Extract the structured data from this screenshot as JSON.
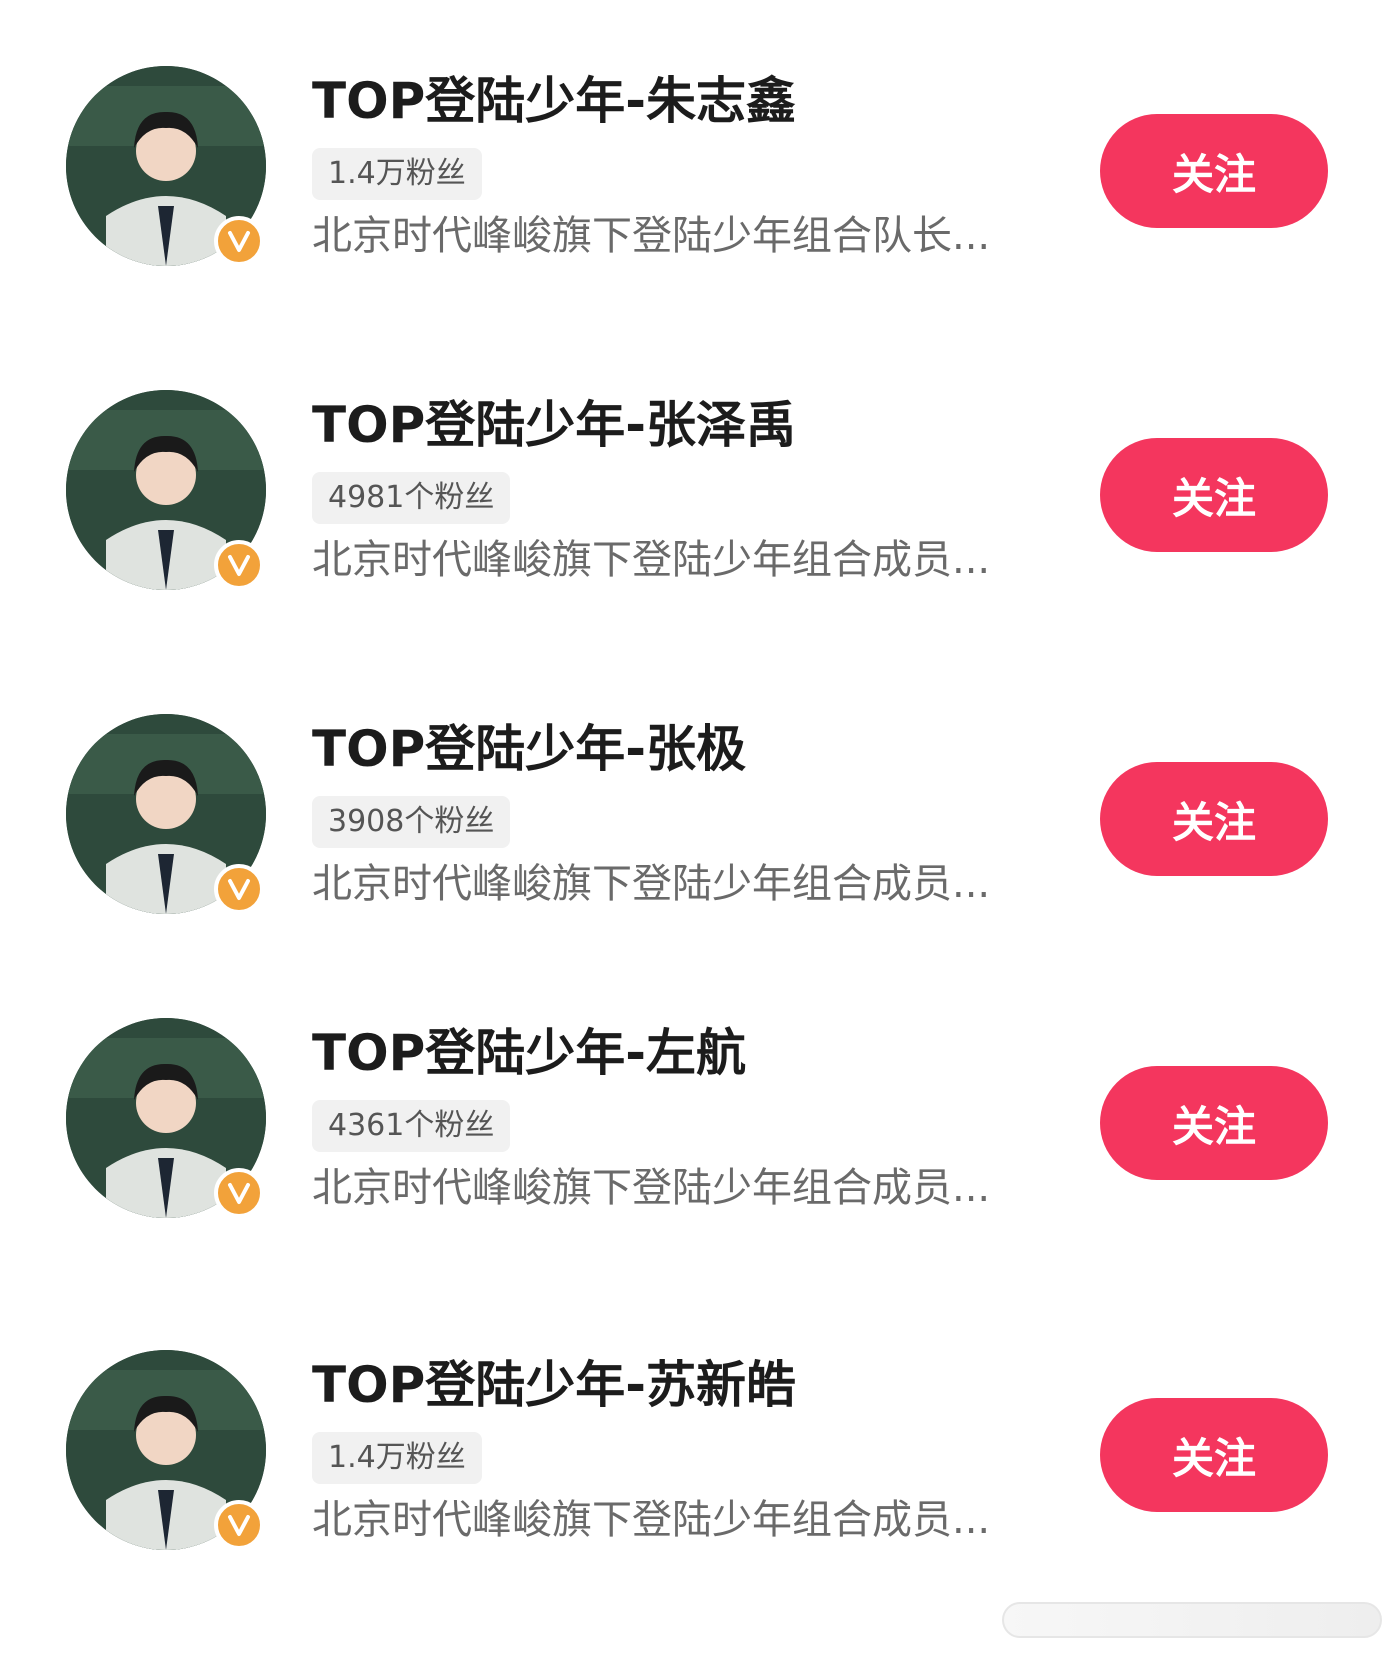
{
  "accounts": [
    {
      "name": "TOP登陆少年-朱志鑫",
      "followers": "1.4万粉丝",
      "description": "北京时代峰峻旗下登陆少年组合队长...",
      "follow_label": "关注",
      "verified_icon": "verified-v-icon"
    },
    {
      "name": "TOP登陆少年-张泽禹",
      "followers": "4981个粉丝",
      "description": "北京时代峰峻旗下登陆少年组合成员...",
      "follow_label": "关注",
      "verified_icon": "verified-v-icon"
    },
    {
      "name": "TOP登陆少年-张极",
      "followers": "3908个粉丝",
      "description": "北京时代峰峻旗下登陆少年组合成员...",
      "follow_label": "关注",
      "verified_icon": "verified-v-icon"
    },
    {
      "name": "TOP登陆少年-左航",
      "followers": "4361个粉丝",
      "description": "北京时代峰峻旗下登陆少年组合成员...",
      "follow_label": "关注",
      "verified_icon": "verified-v-icon"
    },
    {
      "name": "TOP登陆少年-苏新皓",
      "followers": "1.4万粉丝",
      "description": "北京时代峰峻旗下登陆少年组合成员...",
      "follow_label": "关注",
      "verified_icon": "verified-v-icon"
    }
  ],
  "colors": {
    "follow_button": "#f4365e",
    "verified_badge": "#f2a23a",
    "name_text": "#1c1c1c",
    "desc_text": "#6a6a6a"
  }
}
